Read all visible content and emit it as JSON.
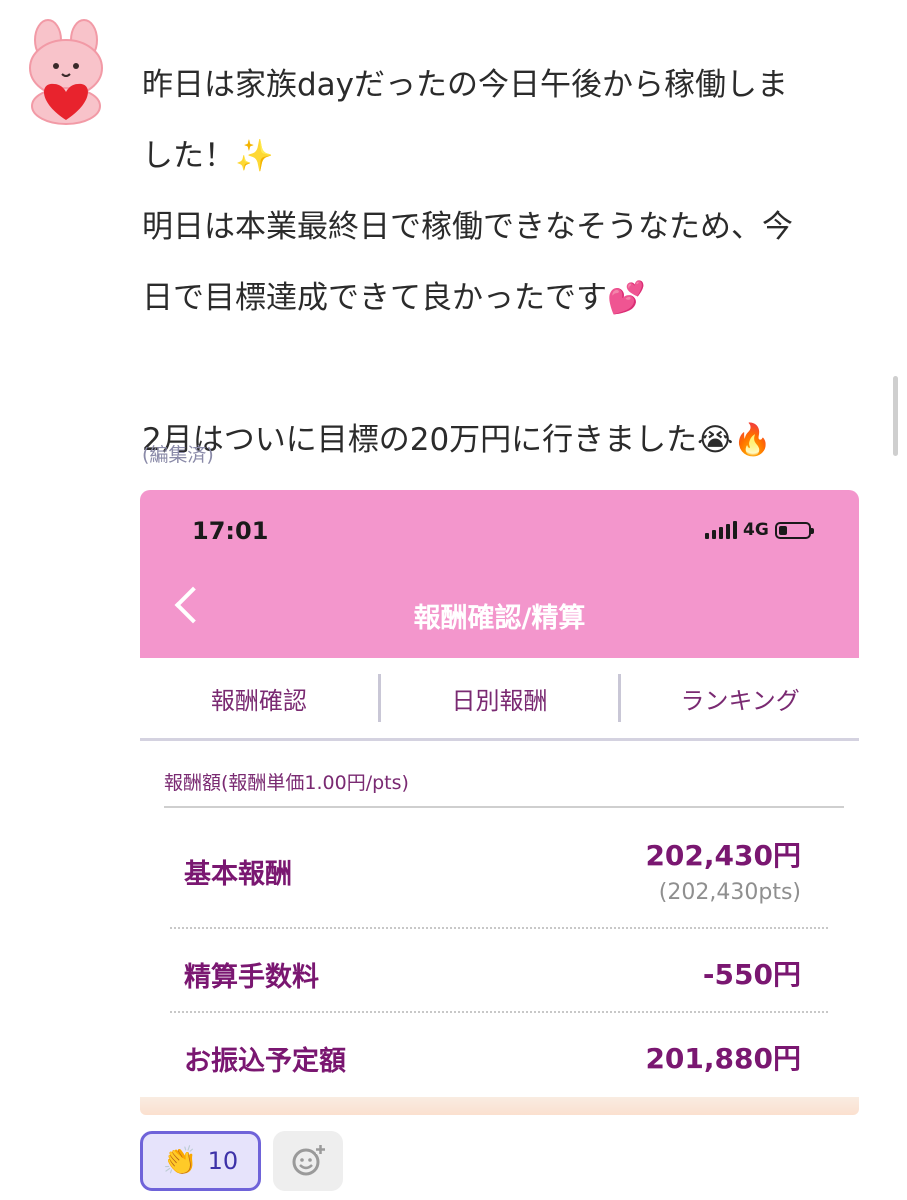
{
  "message": {
    "text": "昨日は家族dayだったの今日午後から稼働しま\nした！✨\n明日は本業最終日で稼働できなそうなため、今\n日で目標達成できて良かったです💕\n\n2月はついに目標の20万円に行きました😭🔥",
    "edited_label": "(編集済)"
  },
  "screenshot": {
    "status_time": "17:01",
    "network": "4G",
    "header_title": "報酬確認/精算",
    "tabs": [
      "報酬確認",
      "日別報酬",
      "ランキング"
    ],
    "rate_note": "報酬額(報酬単価1.00円/pts)",
    "rows": {
      "base_label": "基本報酬",
      "base_value": "202,430円",
      "base_pts": "(202,430pts)",
      "fee_label": "精算手数料",
      "fee_value": "-550円",
      "transfer_label": "お振込予定額",
      "transfer_value": "201,880円"
    },
    "colors": {
      "header_bg": "#f396cc",
      "value_text": "#7a1771"
    }
  },
  "reactions": {
    "clap": {
      "icon": "clap-icon",
      "count": "10"
    },
    "add_icon": "add-reaction-icon"
  }
}
